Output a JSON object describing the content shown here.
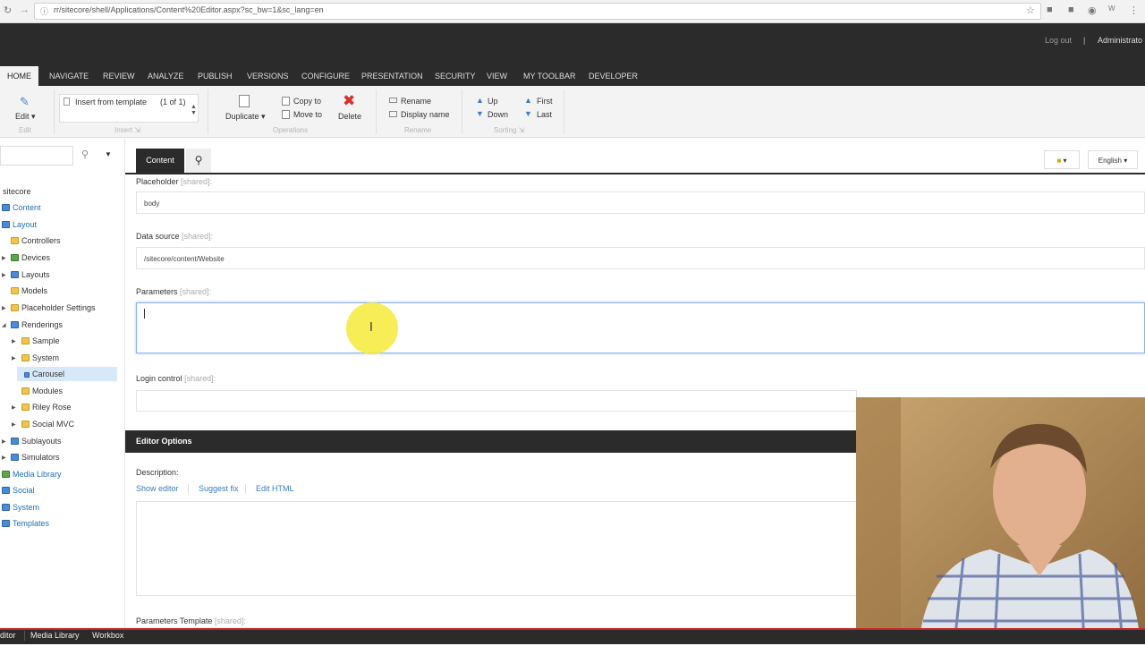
{
  "browser": {
    "url": "rr/sitecore/shell/Applications/Content%20Editor.aspx?sc_bw=1&sc_lang=en"
  },
  "header": {
    "logout": "Log out",
    "separator": "|",
    "user": "Administrato"
  },
  "ribbon_tabs": [
    "HOME",
    "NAVIGATE",
    "REVIEW",
    "ANALYZE",
    "PUBLISH",
    "VERSIONS",
    "CONFIGURE",
    "PRESENTATION",
    "SECURITY",
    "VIEW",
    "MY TOOLBAR",
    "DEVELOPER"
  ],
  "ribbon": {
    "edit": "Edit",
    "insert_template": "Insert from template",
    "insert_count": "(1 of 1)",
    "duplicate": "Duplicate",
    "copy_to": "Copy to",
    "move_to": "Move to",
    "delete": "Delete",
    "rename": "Rename",
    "display_name": "Display name",
    "up": "Up",
    "down": "Down",
    "first": "First",
    "last": "Last",
    "groups": {
      "edit": "Edit",
      "insert": "Insert",
      "operations": "Operations",
      "rename": "Rename",
      "sorting": "Sorting"
    }
  },
  "tree": {
    "root": "sitecore",
    "items": {
      "content": "Content",
      "layout": "Layout",
      "controllers": "Controllers",
      "devices": "Devices",
      "layouts": "Layouts",
      "models": "Models",
      "placeholder_settings": "Placeholder Settings",
      "renderings": "Renderings",
      "sample": "Sample",
      "system_sub": "System",
      "carousel": "Carousel",
      "modules": "Modules",
      "riley_rose": "Riley Rose",
      "social_mvc": "Social MVC",
      "sublayouts": "Sublayouts",
      "simulators": "Simulators",
      "media_library": "Media Library",
      "social": "Social",
      "system": "System",
      "templates": "Templates"
    }
  },
  "editor": {
    "content_tab": "Content",
    "language": "English",
    "fields": {
      "placeholder_label": "Placeholder",
      "placeholder_value": "body",
      "datasource_label": "Data source",
      "datasource_value": "/sitecore/content/Website",
      "parameters_label": "Parameters",
      "login_control_label": "Login control",
      "shared": "[shared]:",
      "description_label": "Description:",
      "params_template_label": "Parameters Template"
    },
    "section_title": "Editor Options",
    "links": {
      "show_editor": "Show editor",
      "suggest_fix": "Suggest fix",
      "edit_html": "Edit HTML"
    }
  },
  "bottom_tabs": {
    "editor": "Editor",
    "media_library": "Media Library",
    "workbox": "Workbox"
  }
}
